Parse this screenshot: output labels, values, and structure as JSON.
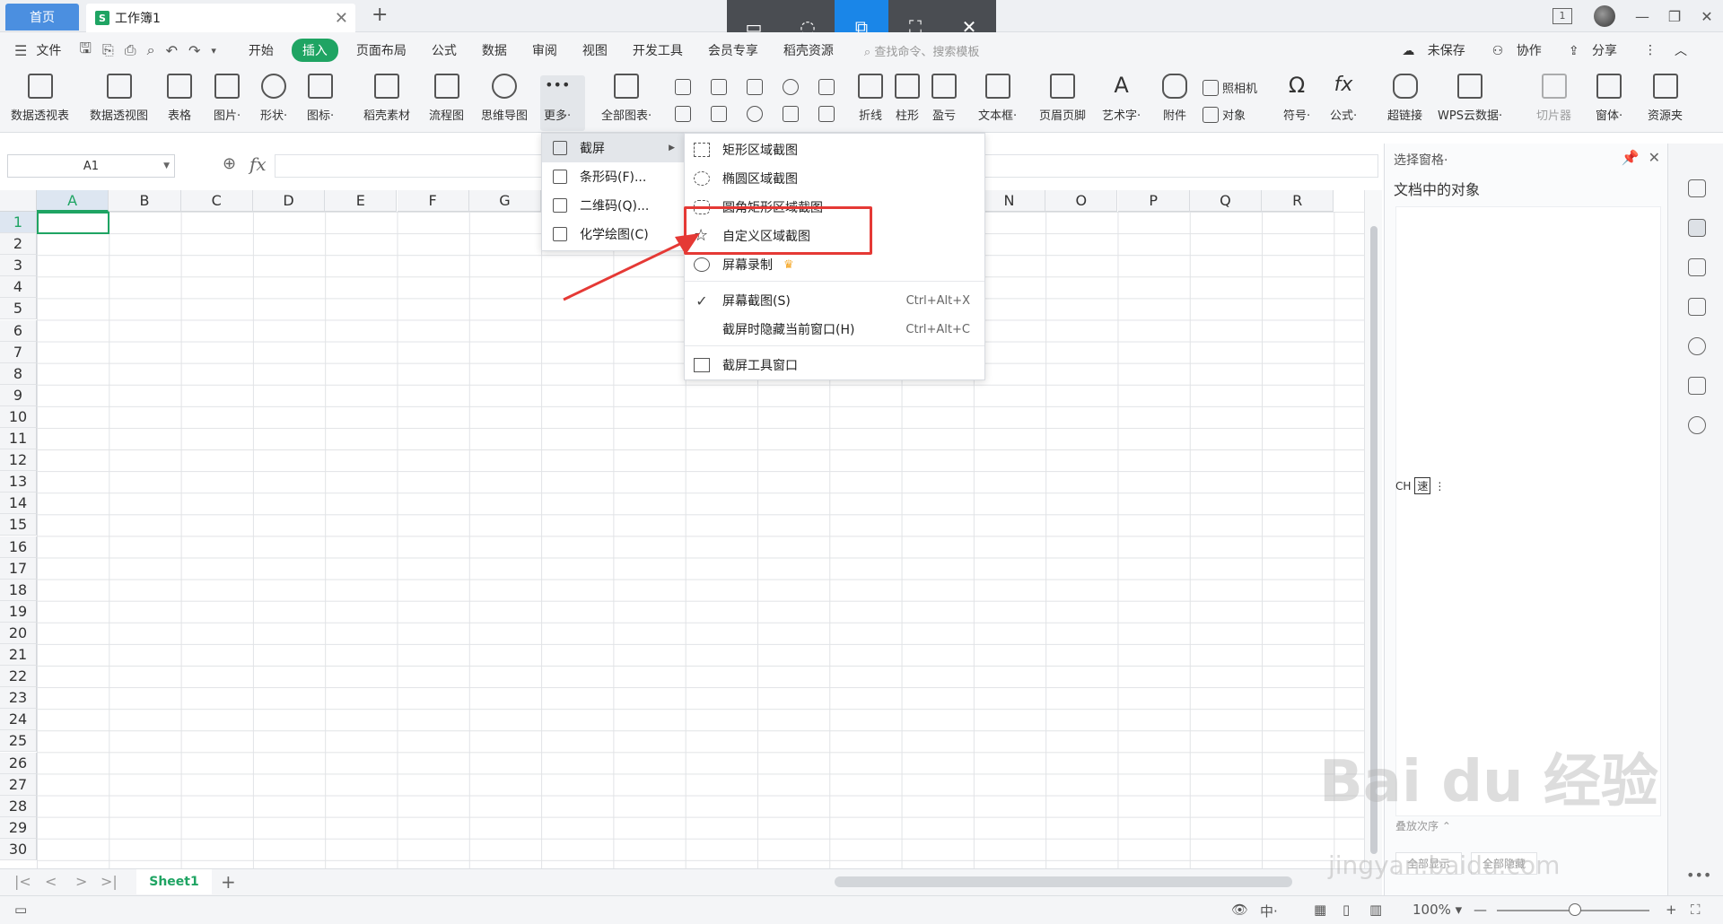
{
  "titlebar": {
    "home_tab": "首页",
    "doc_tab": "工作簿1",
    "doc_icon_letter": "S",
    "page_counter": "1"
  },
  "menu": {
    "items": [
      "文件",
      "开始",
      "插入",
      "页面布局",
      "公式",
      "数据",
      "审阅",
      "视图",
      "开发工具",
      "会员专享",
      "稻壳资源"
    ],
    "search_placeholder": "查找命令、搜索模板",
    "unsaved": "未保存",
    "collab": "协作",
    "share": "分享"
  },
  "ribbon": {
    "buttons": [
      "数据透视表",
      "数据透视图",
      "表格",
      "图片·",
      "形状·",
      "图标·",
      "稻壳素材",
      "流程图",
      "思维导图",
      "更多·",
      "全部图表·",
      "折线",
      "柱形",
      "盈亏",
      "文本框·",
      "页眉页脚",
      "艺术字·",
      "附件",
      "照相机",
      "对象",
      "符号·",
      "公式·",
      "超链接",
      "WPS云数据·",
      "切片器",
      "窗体·",
      "资源夹"
    ]
  },
  "formula": {
    "cell_ref": "A1",
    "fx": "fx"
  },
  "grid": {
    "columns": [
      "A",
      "B",
      "C",
      "D",
      "E",
      "F",
      "G",
      "H",
      "I",
      "J",
      "K",
      "L",
      "M",
      "N",
      "O",
      "P",
      "Q",
      "R"
    ],
    "rows": [
      "1",
      "2",
      "3",
      "4",
      "5",
      "6",
      "7",
      "8",
      "9",
      "10",
      "11",
      "12",
      "13",
      "14",
      "15",
      "16",
      "17",
      "18",
      "19",
      "20",
      "21",
      "22",
      "23",
      "24",
      "25",
      "26",
      "27",
      "28",
      "29",
      "30"
    ]
  },
  "sheets": {
    "active": "Sheet1",
    "add": "+"
  },
  "status": {
    "zoom": "100%"
  },
  "pane": {
    "title": "选择窗格·",
    "subtitle": "文档中的对象",
    "ime_text": "CH",
    "ime_box": "速",
    "foot": "叠放次序",
    "show_all": "全部显示",
    "hide_all": "全部隐藏"
  },
  "more_menu": {
    "items": [
      {
        "label": "截屏",
        "has_submenu": true
      },
      {
        "label": "条形码(F)..."
      },
      {
        "label": "二维码(Q)..."
      },
      {
        "label": "化学绘图(C)"
      }
    ]
  },
  "screenshot_menu": {
    "items": [
      {
        "label": "矩形区域截图"
      },
      {
        "label": "椭圆区域截图"
      },
      {
        "label": "圆角矩形区域截图"
      },
      {
        "label": "自定义区域截图"
      },
      {
        "label": "屏幕录制"
      },
      {
        "label": "屏幕截图(S)",
        "shortcut": "Ctrl+Alt+X",
        "checked": true
      },
      {
        "label": "截屏时隐藏当前窗口(H)",
        "shortcut": "Ctrl+Alt+C"
      },
      {
        "label": "截屏工具窗口"
      }
    ]
  },
  "watermark": {
    "brand": "Bai du 经验",
    "url": "jingyan.baidu.com"
  }
}
